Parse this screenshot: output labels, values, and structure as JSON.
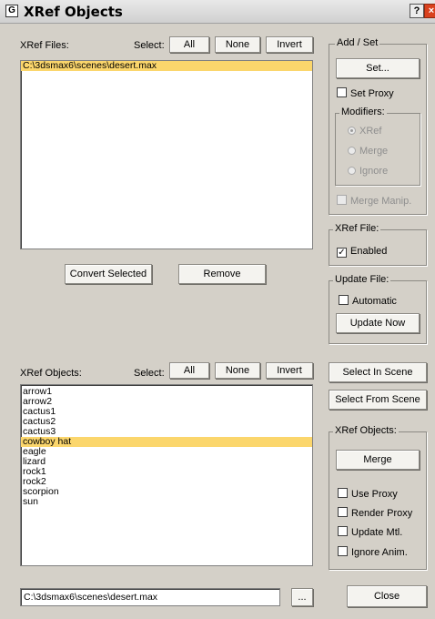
{
  "window": {
    "icon_glyph": "G",
    "title": "XRef Objects",
    "help_label": "?",
    "close_label": "×"
  },
  "files": {
    "label": "XRef Files:",
    "select_label": "Select:",
    "all_label": "All",
    "none_label": "None",
    "invert_label": "Invert",
    "items": [
      "C:\\3dsmax6\\scenes\\desert.max"
    ],
    "selected_index": 0,
    "convert_label": "Convert Selected",
    "remove_label": "Remove"
  },
  "add_set": {
    "title": "Add / Set",
    "set_label": "Set...",
    "set_proxy_label": "Set Proxy",
    "set_proxy_checked": false,
    "modifiers_title": "Modifiers:",
    "modifiers": [
      {
        "label": "XRef",
        "selected": true
      },
      {
        "label": "Merge",
        "selected": false
      },
      {
        "label": "Ignore",
        "selected": false
      }
    ],
    "merge_manip_label": "Merge Manip.",
    "merge_manip_checked": false
  },
  "xref_file": {
    "title": "XRef File:",
    "enabled_label": "Enabled",
    "enabled_checked": true
  },
  "update_file": {
    "title": "Update File:",
    "automatic_label": "Automatic",
    "automatic_checked": false,
    "update_now_label": "Update Now"
  },
  "objects": {
    "label": "XRef Objects:",
    "select_label": "Select:",
    "all_label": "All",
    "none_label": "None",
    "invert_label": "Invert",
    "items": [
      "arrow1",
      "arrow2",
      "cactus1",
      "cactus2",
      "cactus3",
      "cowboy hat",
      "eagle",
      "lizard",
      "rock1",
      "rock2",
      "scorpion",
      "sun"
    ],
    "selected_index": 5
  },
  "scene_buttons": {
    "select_in_scene": "Select In Scene",
    "select_from_scene": "Select From Scene"
  },
  "xref_objects_group": {
    "title": "XRef Objects:",
    "merge_label": "Merge",
    "use_proxy_label": "Use Proxy",
    "render_proxy_label": "Render Proxy",
    "update_mtl_label": "Update Mtl.",
    "ignore_anim_label": "Ignore Anim."
  },
  "footer": {
    "path_value": "C:\\3dsmax6\\scenes\\desert.max",
    "browse_label": "...",
    "close_label": "Close"
  }
}
